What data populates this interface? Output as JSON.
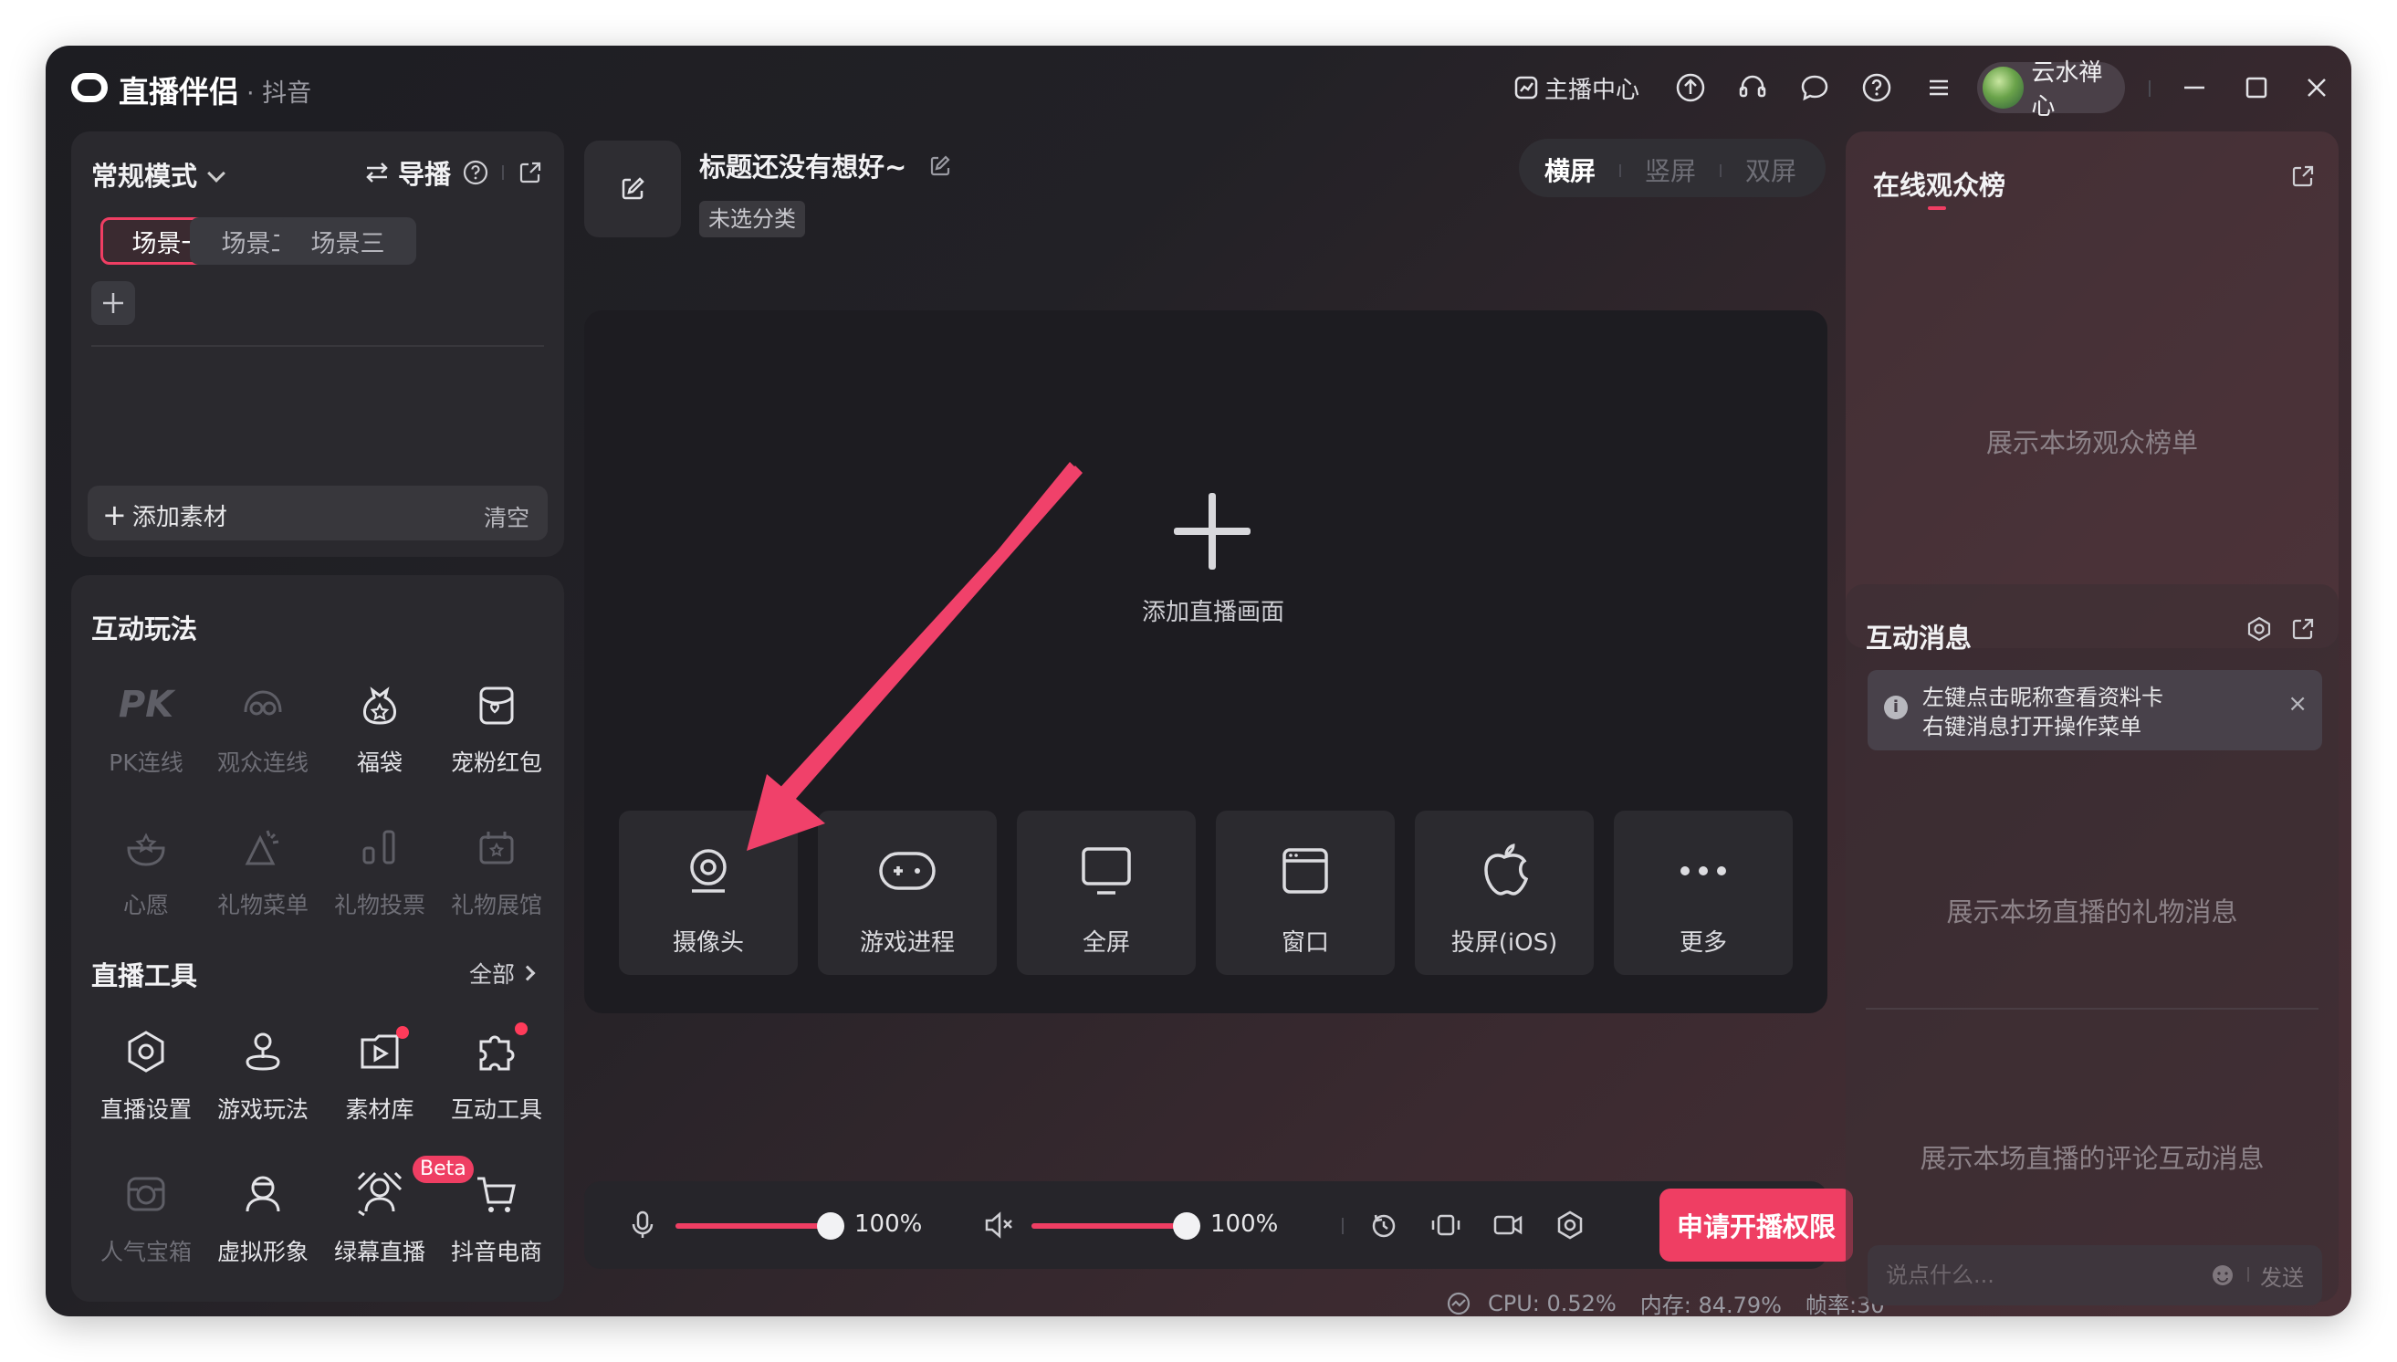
{
  "app": {
    "name": "直播伴侣",
    "platform": "· 抖音"
  },
  "titlebar": {
    "creator_center": "主播中心",
    "username": "云水禅心"
  },
  "scene": {
    "mode": "常规模式",
    "guide": "导播",
    "tabs": [
      "场景一",
      "场景二",
      "场景三"
    ],
    "active_tab": 0,
    "add_material": "添加素材",
    "clear": "清空"
  },
  "interactive_play": {
    "title": "互动玩法",
    "items": [
      {
        "label": "PK连线",
        "icon": "pk-icon",
        "enabled": false
      },
      {
        "label": "观众连线",
        "icon": "audience-link-icon",
        "enabled": false
      },
      {
        "label": "福袋",
        "icon": "lucky-bag-icon",
        "enabled": true
      },
      {
        "label": "宠粉红包",
        "icon": "red-packet-icon",
        "enabled": true
      },
      {
        "label": "心愿",
        "icon": "wish-icon",
        "enabled": false
      },
      {
        "label": "礼物菜单",
        "icon": "gift-menu-icon",
        "enabled": false
      },
      {
        "label": "礼物投票",
        "icon": "gift-vote-icon",
        "enabled": false
      },
      {
        "label": "礼物展馆",
        "icon": "gift-hall-icon",
        "enabled": false
      }
    ]
  },
  "live_tools": {
    "title": "直播工具",
    "all": "全部",
    "items": [
      {
        "label": "直播设置",
        "icon": "settings-hex-icon",
        "enabled": true
      },
      {
        "label": "游戏玩法",
        "icon": "joystick-icon",
        "enabled": true
      },
      {
        "label": "素材库",
        "icon": "media-library-icon",
        "enabled": true
      },
      {
        "label": "互动工具",
        "icon": "puzzle-icon",
        "enabled": true
      },
      {
        "label": "人气宝箱",
        "icon": "treasure-box-icon",
        "enabled": false
      },
      {
        "label": "虚拟形象",
        "icon": "avatar-icon",
        "enabled": true
      },
      {
        "label": "绿幕直播",
        "icon": "green-screen-icon",
        "enabled": true
      },
      {
        "label": "抖音电商",
        "icon": "cart-icon",
        "enabled": true
      }
    ],
    "beta_badge": "Beta"
  },
  "stream": {
    "title": "标题还没有想好~",
    "category": "未选分类"
  },
  "orientation": {
    "options": [
      "横屏",
      "竖屏",
      "双屏"
    ],
    "active": 0
  },
  "preview": {
    "add_label": "添加直播画面",
    "sources": [
      {
        "label": "摄像头",
        "icon": "camera-icon"
      },
      {
        "label": "游戏进程",
        "icon": "gamepad-icon"
      },
      {
        "label": "全屏",
        "icon": "monitor-icon"
      },
      {
        "label": "窗口",
        "icon": "window-icon"
      },
      {
        "label": "投屏(iOS)",
        "icon": "apple-icon"
      },
      {
        "label": "更多",
        "icon": "more-icon"
      }
    ]
  },
  "audio": {
    "mic_volume": "100%",
    "speaker_volume": "100%",
    "mic_level": 1.0,
    "speaker_level": 1.0
  },
  "go_live_label": "申请开播权限",
  "status": {
    "cpu": "CPU: 0.52%",
    "memory": "内存: 84.79%",
    "fps": "帧率:30"
  },
  "audience": {
    "title": "在线观众榜",
    "placeholder": "展示本场观众榜单"
  },
  "messages": {
    "title": "互动消息",
    "notice_line1": "左键点击昵称查看资料卡",
    "notice_line2": "右键消息打开操作菜单",
    "gift_placeholder": "展示本场直播的礼物消息",
    "comment_placeholder": "展示本场直播的评论互动消息",
    "input_placeholder": "说点什么...",
    "send": "发送"
  },
  "colors": {
    "accent": "#ef3e63"
  }
}
